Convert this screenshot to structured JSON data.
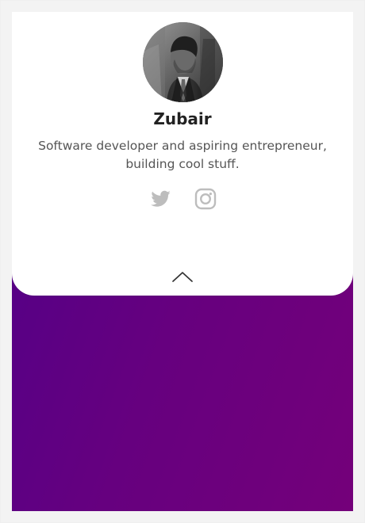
{
  "profile": {
    "name": "Zubair",
    "bio": "Software developer and aspiring entrepreneur, building cool stuff.",
    "avatar_icon": "person-photo",
    "social_links": [
      {
        "icon": "twitter-icon"
      },
      {
        "icon": "instagram-icon"
      }
    ]
  },
  "controls": {
    "collapse_icon": "chevron-up-icon"
  },
  "colors": {
    "panel_background": "#ffffff",
    "gradient_start": "#4f0089",
    "gradient_end": "#74007a",
    "icon_gray": "#bdbdbd",
    "text_dark": "#222222",
    "text_secondary": "#555555"
  }
}
